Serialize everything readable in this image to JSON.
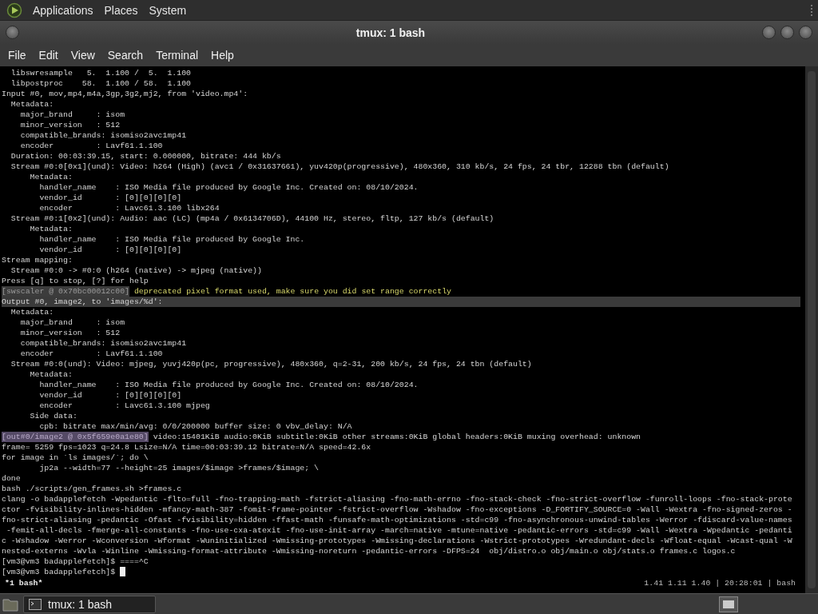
{
  "top_panel": {
    "menus": [
      "Applications",
      "Places",
      "System"
    ]
  },
  "window": {
    "title": "tmux: 1 bash",
    "menu": [
      "File",
      "Edit",
      "View",
      "Search",
      "Terminal",
      "Help"
    ]
  },
  "terminal": {
    "cursor": true,
    "lines": [
      {
        "kind": "plain",
        "text": "  libswresample   5.  1.100 /  5.  1.100"
      },
      {
        "kind": "plain",
        "text": "  libpostproc    58.  1.100 / 58.  1.100"
      },
      {
        "kind": "plain",
        "text": "Input #0, mov,mp4,m4a,3gp,3g2,mj2, from 'video.mp4':"
      },
      {
        "kind": "plain",
        "text": "  Metadata:"
      },
      {
        "kind": "plain",
        "text": "    major_brand     : isom"
      },
      {
        "kind": "plain",
        "text": "    minor_version   : 512"
      },
      {
        "kind": "plain",
        "text": "    compatible_brands: isomiso2avc1mp41"
      },
      {
        "kind": "plain",
        "text": "    encoder         : Lavf61.1.100"
      },
      {
        "kind": "plain",
        "text": "  Duration: 00:03:39.15, start: 0.000000, bitrate: 444 kb/s"
      },
      {
        "kind": "plain",
        "text": "  Stream #0:0[0x1](und): Video: h264 (High) (avc1 / 0x31637661), yuv420p(progressive), 480x360, 310 kb/s, 24 fps, 24 tbr, 12288 tbn (default)"
      },
      {
        "kind": "plain",
        "text": "      Metadata:"
      },
      {
        "kind": "plain",
        "text": "        handler_name    : ISO Media file produced by Google Inc. Created on: 08/10/2024."
      },
      {
        "kind": "plain",
        "text": "        vendor_id       : [0][0][0][0]"
      },
      {
        "kind": "plain",
        "text": "        encoder         : Lavc61.3.100 libx264"
      },
      {
        "kind": "plain",
        "text": "  Stream #0:1[0x2](und): Audio: aac (LC) (mp4a / 0x6134706D), 44100 Hz, stereo, fltp, 127 kb/s (default)"
      },
      {
        "kind": "plain",
        "text": "      Metadata:"
      },
      {
        "kind": "plain",
        "text": "        handler_name    : ISO Media file produced by Google Inc."
      },
      {
        "kind": "plain",
        "text": "        vendor_id       : [0][0][0][0]"
      },
      {
        "kind": "plain",
        "text": "Stream mapping:"
      },
      {
        "kind": "plain",
        "text": "  Stream #0:0 -> #0:0 (h264 (native) -> mjpeg (native))"
      },
      {
        "kind": "plain",
        "text": "Press [q] to stop, [?] for help"
      },
      {
        "kind": "warning",
        "prefix": "[swscaler @ 0x70bc00012c00]",
        "text": " deprecated pixel format used, make sure you did set range correctly"
      },
      {
        "kind": "highlight",
        "text": "Output #0, image2, to 'images/%d':"
      },
      {
        "kind": "plain",
        "text": "  Metadata:"
      },
      {
        "kind": "plain",
        "text": "    major_brand     : isom"
      },
      {
        "kind": "plain",
        "text": "    minor_version   : 512"
      },
      {
        "kind": "plain",
        "text": "    compatible_brands: isomiso2avc1mp41"
      },
      {
        "kind": "plain",
        "text": "    encoder         : Lavf61.1.100"
      },
      {
        "kind": "plain",
        "text": "  Stream #0:0(und): Video: mjpeg, yuvj420p(pc, progressive), 480x360, q=2-31, 200 kb/s, 24 fps, 24 tbn (default)"
      },
      {
        "kind": "plain",
        "text": "      Metadata:"
      },
      {
        "kind": "plain",
        "text": "        handler_name    : ISO Media file produced by Google Inc. Created on: 08/10/2024."
      },
      {
        "kind": "plain",
        "text": "        vendor_id       : [0][0][0][0]"
      },
      {
        "kind": "plain",
        "text": "        encoder         : Lavc61.3.100 mjpeg"
      },
      {
        "kind": "plain",
        "text": "      Side data:"
      },
      {
        "kind": "plain",
        "text": "        cpb: bitrate max/min/avg: 0/0/200000 buffer size: 0 vbv_delay: N/A"
      },
      {
        "kind": "tagged",
        "prefix": "[out#0/image2 @ 0x5f659e0a1e80]",
        "text": " video:15401KiB audio:0KiB subtitle:0KiB other streams:0KiB global headers:0KiB muxing overhead: unknown"
      },
      {
        "kind": "plain",
        "text": "frame= 5259 fps=1023 q=24.8 Lsize=N/A time=00:03:39.12 bitrate=N/A speed=42.6x"
      },
      {
        "kind": "plain",
        "text": "for image in `ls images/`; do \\"
      },
      {
        "kind": "plain",
        "text": "        jp2a --width=77 --height=25 images/$image >frames/$image; \\"
      },
      {
        "kind": "plain",
        "text": "done"
      },
      {
        "kind": "plain",
        "text": "bash ./scripts/gen_frames.sh >frames.c"
      },
      {
        "kind": "plain",
        "text": "clang -o badapplefetch -Wpedantic -flto=full -fno-trapping-math -fstrict-aliasing -fno-math-errno -fno-stack-check -fno-strict-overflow -funroll-loops -fno-stack-prote"
      },
      {
        "kind": "plain",
        "text": "ctor -fvisibility-inlines-hidden -mfancy-math-387 -fomit-frame-pointer -fstrict-overflow -Wshadow -fno-exceptions -D_FORTIFY_SOURCE=0 -Wall -Wextra -fno-signed-zeros -"
      },
      {
        "kind": "plain",
        "text": "fno-strict-aliasing -pedantic -Ofast -fvisibility=hidden -ffast-math -funsafe-math-optimizations -std=c99 -fno-asynchronous-unwind-tables -Werror -fdiscard-value-names"
      },
      {
        "kind": "plain",
        "text": " -femit-all-decls -fmerge-all-constants -fno-use-cxa-atexit -fno-use-init-array -march=native -mtune=native -pedantic-errors -std=c99 -Wall -Wextra -Wpedantic -pedanti"
      },
      {
        "kind": "plain",
        "text": "c -Wshadow -Werror -Wconversion -Wformat -Wuninitialized -Wmissing-prototypes -Wmissing-declarations -Wstrict-prototypes -Wredundant-decls -Wfloat-equal -Wcast-qual -W"
      },
      {
        "kind": "plain",
        "text": "nested-externs -Wvla -Winline -Wmissing-format-attribute -Wmissing-noreturn -pedantic-errors -DFPS=24  obj/distro.o obj/main.o obj/stats.o frames.c logos.c"
      },
      {
        "kind": "plain",
        "text": "[vm3@vm3 badapplefetch]$ ====^C"
      },
      {
        "kind": "plain",
        "text": "[vm3@vm3 badapplefetch]$"
      }
    ]
  },
  "tmux_status": {
    "window": "*1 bash*",
    "right": "1.41 1.11 1.40 | 20:28:01 | bash"
  },
  "taskbar": {
    "tasks": [
      {
        "label": "tmux: 1 bash",
        "selected": true
      }
    ]
  }
}
